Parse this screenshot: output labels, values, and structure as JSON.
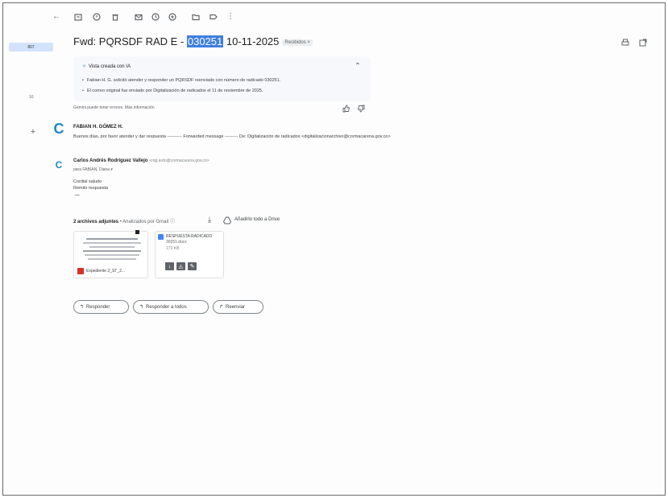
{
  "sidebar": {
    "badge": "807",
    "label": "10"
  },
  "message": {
    "subject_prefix": "Fwd: PQRSDF RAD E - ",
    "subject_highlight": "030251",
    "subject_suffix": " 10-11-2025",
    "label_chip": "Recibidos ×",
    "ai_summary": {
      "title": "Vista creada con IA",
      "bullets": [
        "Fabian H. G. solicitó atender y responder un PQRSDF reenviado con número de radicado 030251.",
        "El correo original fue enviado por Digitalización de radicados el 11 de noviembre de 2025."
      ],
      "disclaimer": "Gemini puede tener errores. Más información"
    }
  },
  "thread": [
    {
      "avatar": "C",
      "sender": "FABIAN H. GÓMEZ H.",
      "preview": "Buenos días, por favor atender y dar respuesta ---------- Forwarded message --------- De: Digitalización de radicados <digitalizacionarchivo@cormacarena.gov.co>"
    },
    {
      "avatar": "C",
      "sender": "Carlos Andrés Rodríguez Vallejo",
      "sender_email": "<rdg.ardo@cormacarena.gov.co>",
      "to_line": "para FABIAN, Diana ▾",
      "body": [
        "Cordial saludo",
        "Remito respuesta",
        "—"
      ]
    }
  ],
  "attachments": {
    "header": "2 archivos adjuntes",
    "scanned": " • Analizados por Gmail ⓘ",
    "add_drive": "Añadirlo todo a Drive",
    "files": [
      {
        "name": "Expediente 2_ST_2...",
        "type": "PDF"
      },
      {
        "name": "RESPUESTA RADICADO",
        "sub": "30251.docx",
        "size": "173 KB"
      }
    ]
  },
  "actions": {
    "reply": "Responder",
    "reply_all": "Responder a todos",
    "forward": "Reenviar"
  },
  "colors": {
    "highlight": "#3d7fe0",
    "avatar": "#1e88c8",
    "sidebar_pill": "#d3e3fd"
  }
}
